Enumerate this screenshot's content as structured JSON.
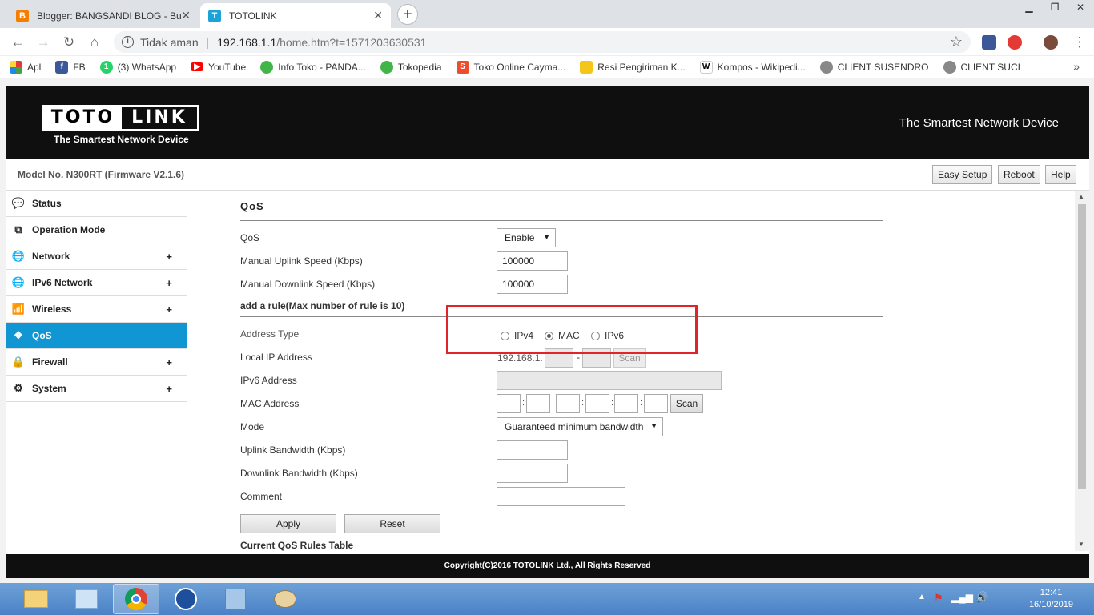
{
  "browser": {
    "tabs": [
      {
        "title": "Blogger: BANGSANDI BLOG - Bu",
        "icon": "blogger-icon"
      },
      {
        "title": "TOTOLINK",
        "icon": "totolink-icon"
      }
    ],
    "security_label": "Tidak aman",
    "url_host": "192.168.1.1",
    "url_path": "/home.htm?t=1571203630531",
    "bookmarks": [
      {
        "label": "Apl",
        "icon": "apps-grid-icon"
      },
      {
        "label": "FB",
        "icon": "facebook-icon"
      },
      {
        "label": "(3) WhatsApp",
        "icon": "whatsapp-icon"
      },
      {
        "label": "YouTube",
        "icon": "youtube-icon"
      },
      {
        "label": "Info Toko - PANDA...",
        "icon": "tokopedia-icon"
      },
      {
        "label": "Tokopedia",
        "icon": "tokopedia-icon"
      },
      {
        "label": "Toko Online Cayma...",
        "icon": "shopee-icon"
      },
      {
        "label": "Resi Pengiriman K...",
        "icon": "envelope-icon"
      },
      {
        "label": "Kompos - Wikipedi...",
        "icon": "wikipedia-icon"
      },
      {
        "label": "CLIENT SUSENDRO",
        "icon": "globe-icon"
      },
      {
        "label": "CLIENT SUCI",
        "icon": "globe-icon"
      }
    ]
  },
  "router": {
    "logo_left": "TOTO",
    "logo_right": "LINK",
    "logo_tagline": "The Smartest Network Device",
    "header_slogan": "The Smartest Network Device",
    "model": "Model No. N300RT (Firmware V2.1.6)",
    "top_buttons": {
      "easy_setup": "Easy Setup",
      "reboot": "Reboot",
      "help": "Help"
    },
    "nav": [
      {
        "label": "Status",
        "icon": "speech-bubble-icon",
        "expandable": false,
        "active": false
      },
      {
        "label": "Operation Mode",
        "icon": "windows-icon",
        "expandable": false,
        "active": false
      },
      {
        "label": "Network",
        "icon": "globe-icon",
        "expandable": true,
        "active": false
      },
      {
        "label": "IPv6 Network",
        "icon": "globe-icon",
        "expandable": true,
        "active": false
      },
      {
        "label": "Wireless",
        "icon": "wifi-icon",
        "expandable": true,
        "active": false
      },
      {
        "label": "QoS",
        "icon": "qos-icon",
        "expandable": false,
        "active": true
      },
      {
        "label": "Firewall",
        "icon": "lock-icon",
        "expandable": true,
        "active": false
      },
      {
        "label": "System",
        "icon": "gear-icon",
        "expandable": true,
        "active": false
      }
    ],
    "plus": "+",
    "qos": {
      "title": "QoS",
      "qos_label": "QoS",
      "qos_value": "Enable",
      "uplink_label": "Manual Uplink Speed (Kbps)",
      "uplink_value": "100000",
      "downlink_label": "Manual Downlink Speed (Kbps)",
      "downlink_value": "100000",
      "rule_heading": "add a rule(Max number of rule is 10)",
      "address_type_label": "Address Type",
      "address_types": [
        {
          "label": "IPv4",
          "checked": false
        },
        {
          "label": "MAC",
          "checked": true
        },
        {
          "label": "IPv6",
          "checked": false
        }
      ],
      "local_ip_label": "Local IP Address",
      "local_ip_prefix": "192.168.1.",
      "local_ip_dash": "-",
      "scan_label": "Scan",
      "ipv6_label": "IPv6 Address",
      "mac_label": "MAC Address",
      "mac_sep": ":",
      "mode_label": "Mode",
      "mode_value": "Guaranteed minimum bandwidth",
      "uplink_bw_label": "Uplink Bandwidth (Kbps)",
      "downlink_bw_label": "Downlink Bandwidth (Kbps)",
      "comment_label": "Comment",
      "apply_label": "Apply",
      "reset_label": "Reset",
      "rules_table_heading": "Current QoS Rules Table"
    },
    "footer": "Copyright(C)2016 TOTOLINK Ltd., All Rights Reserved"
  },
  "taskbar": {
    "time": "12:41",
    "date": "16/10/2019"
  }
}
